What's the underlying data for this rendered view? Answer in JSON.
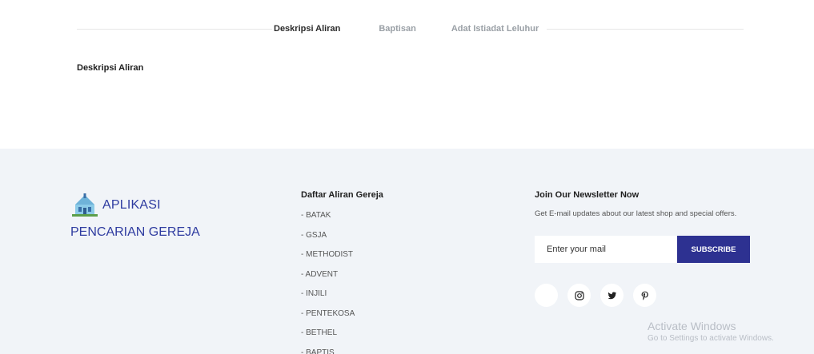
{
  "tabs": [
    {
      "label": "Deskripsi Aliran",
      "active": true
    },
    {
      "label": "Baptisan",
      "active": false
    },
    {
      "label": "Adat Istiadat Leluhur",
      "active": false
    }
  ],
  "content": {
    "section_title": "Deskripsi Aliran"
  },
  "footer": {
    "brand_line1": "APLIKASI",
    "brand_line2": "PENCARIAN GEREJA",
    "list_title": "Daftar Aliran Gereja",
    "list_items": [
      "- BATAK",
      "- GSJA",
      "- METHODIST",
      "- ADVENT",
      "- INJILI",
      "- PENTEKOSA",
      "- BETHEL",
      "- BAPTIS"
    ],
    "newsletter_title": "Join Our Newsletter Now",
    "newsletter_desc": "Get E-mail updates about our latest shop and special offers.",
    "newsletter_placeholder": "Enter your mail",
    "subscribe_label": "SUBSCRIBE",
    "socials": [
      "facebook-icon",
      "instagram-icon",
      "twitter-icon",
      "pinterest-icon"
    ]
  },
  "watermark": {
    "line1": "Activate Windows",
    "line2": "Go to Settings to activate Windows."
  },
  "colors": {
    "brand": "#2f3ca0",
    "button": "#2d3191",
    "footer_bg": "#f1f4f8"
  }
}
